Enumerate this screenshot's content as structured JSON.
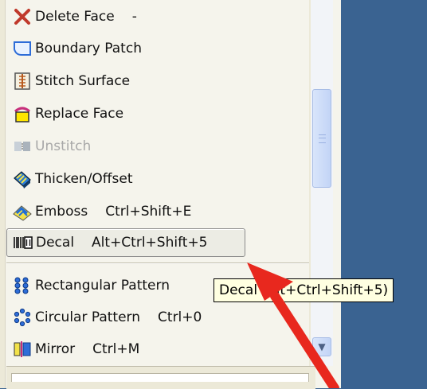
{
  "menu": {
    "items": [
      {
        "label": "Delete Face",
        "shortcut": "-",
        "icon": "delete-face-icon"
      },
      {
        "label": "Boundary Patch",
        "shortcut": "",
        "icon": "boundary-patch-icon"
      },
      {
        "label": "Stitch Surface",
        "shortcut": "",
        "icon": "stitch-surface-icon"
      },
      {
        "label": "Replace Face",
        "shortcut": "",
        "icon": "replace-face-icon"
      },
      {
        "label": "Unstitch",
        "shortcut": "",
        "icon": "unstitch-icon",
        "disabled": true
      },
      {
        "label": "Thicken/Offset",
        "shortcut": "",
        "icon": "thicken-offset-icon"
      },
      {
        "label": "Emboss",
        "shortcut": "Ctrl+Shift+E",
        "icon": "emboss-icon"
      },
      {
        "label": "Decal",
        "shortcut": "Alt+Ctrl+Shift+5",
        "icon": "decal-icon",
        "highlighted": true
      },
      {
        "label": "Rectangular Pattern",
        "shortcut": "",
        "icon": "rectangular-pattern-icon"
      },
      {
        "label": "Circular Pattern",
        "shortcut": "Ctrl+0",
        "icon": "circular-pattern-icon"
      },
      {
        "label": "Mirror",
        "shortcut": "Ctrl+M",
        "icon": "mirror-icon"
      }
    ]
  },
  "tooltip": {
    "text": "Decal (Alt+Ctrl+Shift+5)"
  },
  "colors": {
    "desktop": "#3A6391",
    "menu_bg": "#F5F4EC",
    "tooltip_bg": "#FFFFE1",
    "arrow": "#E8281E"
  }
}
